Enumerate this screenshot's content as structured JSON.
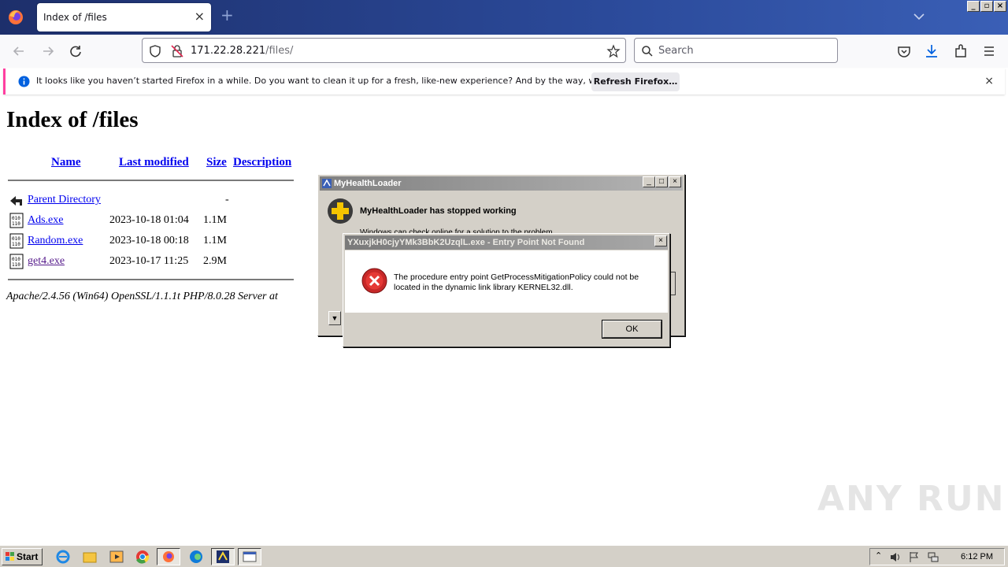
{
  "browser": {
    "tab": {
      "title": "Index of /files",
      "close": "×"
    },
    "new_tab": "+",
    "url": {
      "host": "171.22.28.221",
      "path": "/files/"
    },
    "search_placeholder": "Search"
  },
  "notification": {
    "text": "It looks like you haven’t started Firefox in a while. Do you want to clean it up for a fresh, like-new experience? And by the way, welcome back!",
    "button": "Refresh Firefox…",
    "close": "×"
  },
  "page": {
    "heading": "Index of /files",
    "columns": [
      "Name",
      "Last modified",
      "Size",
      "Description"
    ],
    "rows": [
      {
        "name": "Parent Directory",
        "modified": "",
        "size": "-"
      },
      {
        "name": "Ads.exe",
        "modified": "2023-10-18 01:04",
        "size": "1.1M"
      },
      {
        "name": "Random.exe",
        "modified": "2023-10-18 00:18",
        "size": "1.1M"
      },
      {
        "name": "get4.exe",
        "modified": "2023-10-17 11:25",
        "size": "2.9M"
      }
    ],
    "address": "Apache/2.4.56 (Win64) OpenSSL/1.1.1t PHP/8.0.28 Server at"
  },
  "dialog_crash": {
    "title": "MyHealthLoader",
    "heading": "MyHealthLoader has stopped working",
    "subtext": "Windows can check online for a solution to the problem."
  },
  "dialog_error": {
    "title": "YXuxjkH0cjyYMk3BbK2UzqlL.exe - Entry Point Not Found",
    "message": "The procedure entry point GetProcessMitigationPolicy could not be located in the dynamic link library KERNEL32.dll.",
    "ok": "OK"
  },
  "taskbar": {
    "start": "Start",
    "clock": "6:12 PM"
  },
  "watermark": "ANY RUN",
  "colors": {
    "link": "#0000ee",
    "visited": "#551a8b",
    "notif_accent": "#ff3fa0",
    "error_red": "#c62828"
  }
}
